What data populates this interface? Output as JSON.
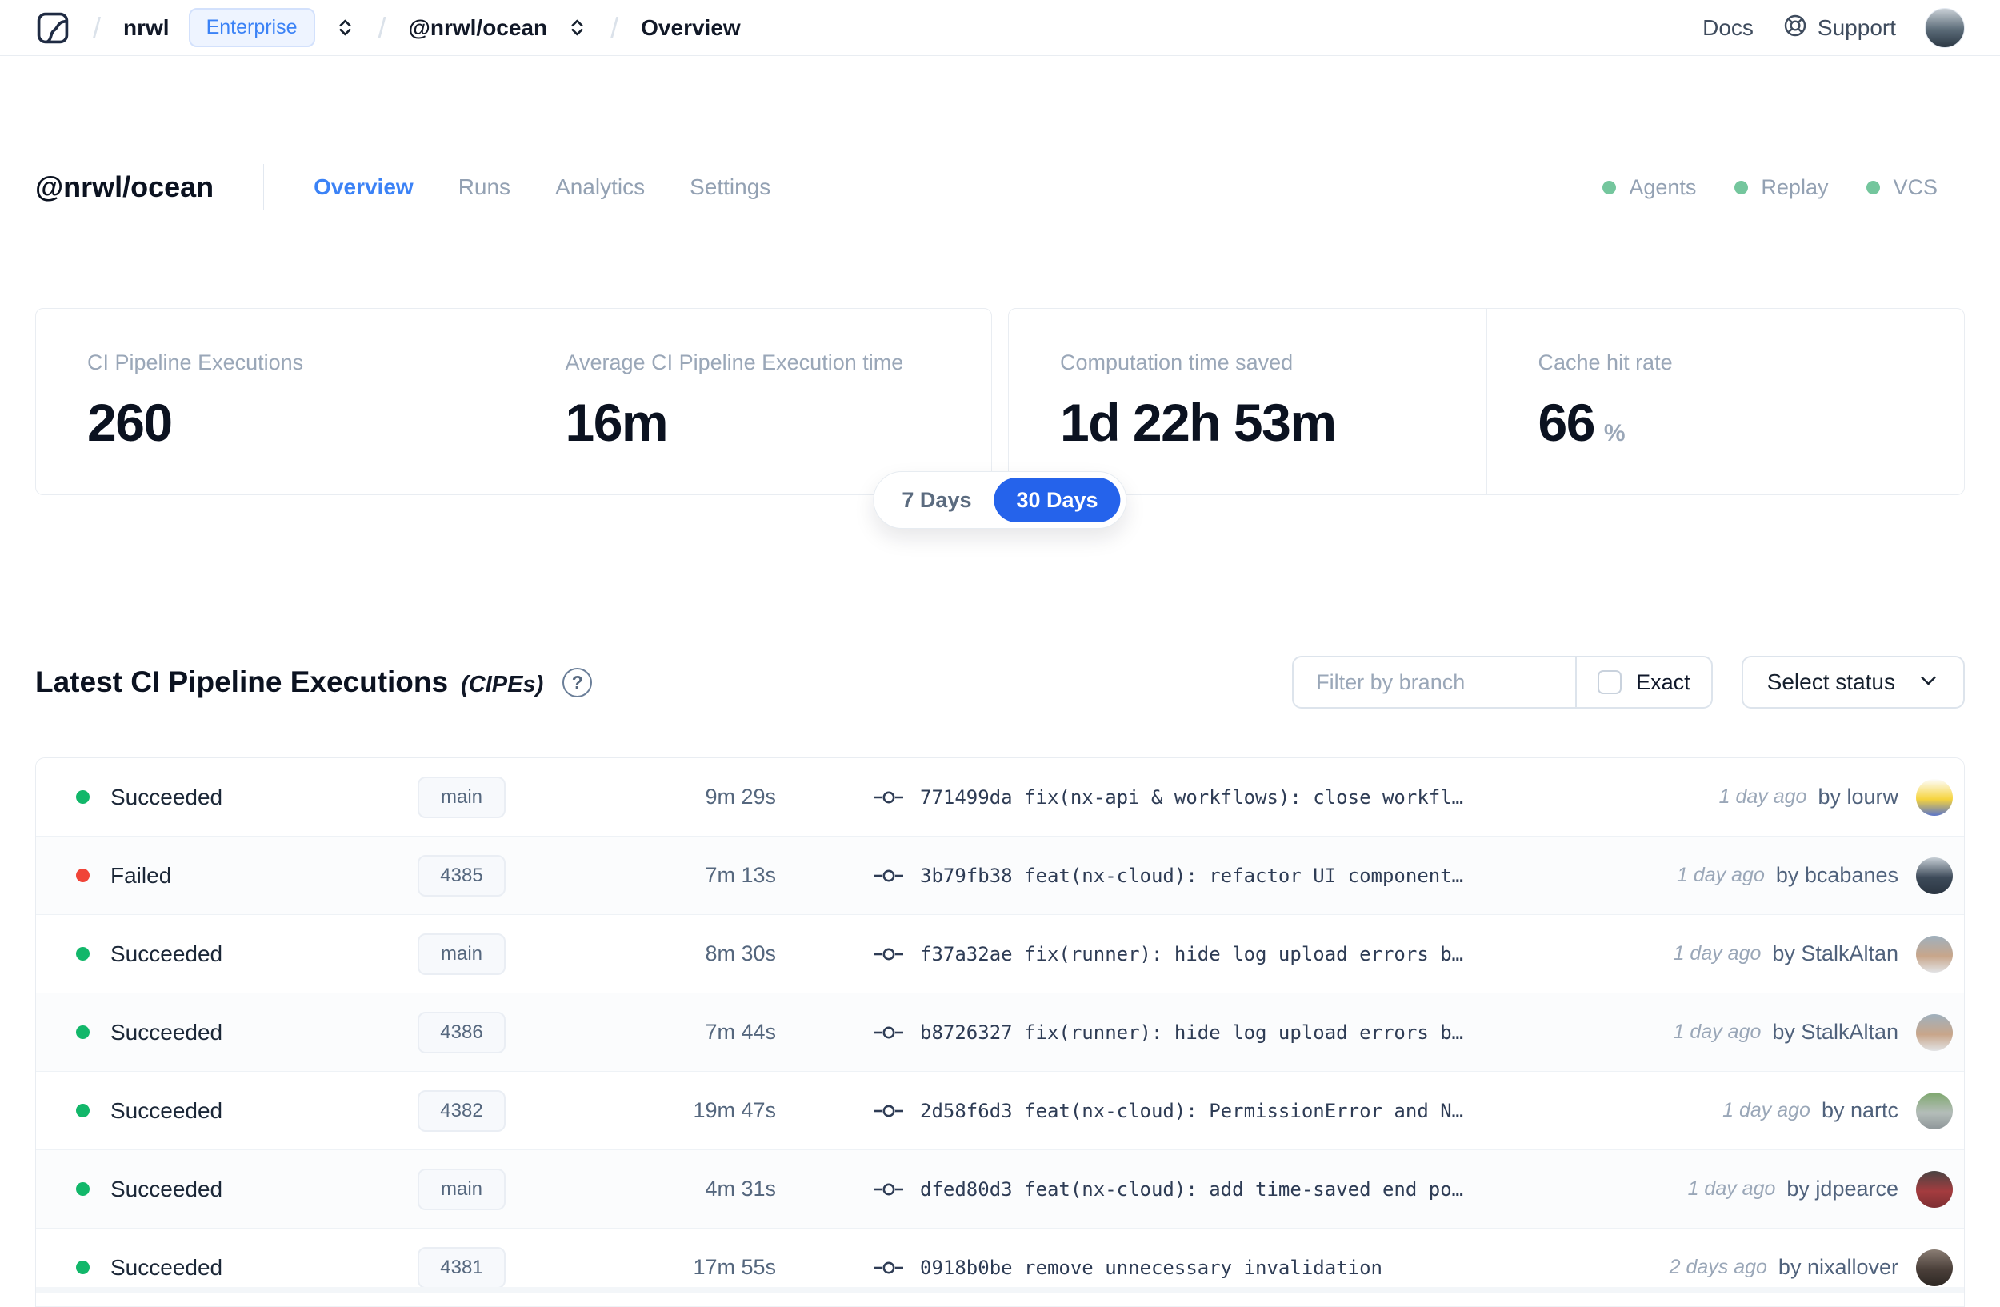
{
  "navbar": {
    "breadcrumb": {
      "org": "nrwl",
      "org_badge": "Enterprise",
      "workspace": "@nrwl/ocean",
      "page": "Overview"
    },
    "docs": "Docs",
    "support": "Support",
    "user_avatar_colors": [
      "#c9d0d6",
      "#5a6a77",
      "#2c3844"
    ]
  },
  "workspace_header": {
    "title": "@nrwl/ocean",
    "tabs": [
      {
        "label": "Overview",
        "active": true
      },
      {
        "label": "Runs",
        "active": false
      },
      {
        "label": "Analytics",
        "active": false
      },
      {
        "label": "Settings",
        "active": false
      }
    ],
    "statuses": [
      {
        "label": "Agents",
        "color": "#74c69d"
      },
      {
        "label": "Replay",
        "color": "#74c69d"
      },
      {
        "label": "VCS",
        "color": "#74c69d"
      }
    ]
  },
  "stats": {
    "cards": [
      {
        "label": "CI Pipeline Executions",
        "value": "260",
        "suffix": ""
      },
      {
        "label": "Average CI Pipeline Execution time",
        "value": "16m",
        "suffix": ""
      },
      {
        "label": "Computation time saved",
        "value": "1d 22h 53m",
        "suffix": ""
      },
      {
        "label": "Cache hit rate",
        "value": "66",
        "suffix": "%"
      }
    ],
    "range_toggle": {
      "options": [
        "7 Days",
        "30 Days"
      ],
      "selected": "30 Days"
    }
  },
  "cipe_section": {
    "title": "Latest CI Pipeline Executions",
    "title_suffix": "(CIPEs)",
    "help_glyph": "?",
    "filter": {
      "placeholder": "Filter by branch",
      "exact_label": "Exact",
      "exact_checked": false
    },
    "status_dropdown": {
      "label": "Select status"
    },
    "rows": [
      {
        "status": "Succeeded",
        "status_color": "#12b76a",
        "branch": "main",
        "duration": "9m 29s",
        "commit": "771499da fix(nx-api & workflows): close workfl…",
        "time": "1 day ago",
        "author": "by lourw",
        "avatar": [
          "#fdfdfd",
          "#f6d43e",
          "#5a74c9"
        ]
      },
      {
        "status": "Failed",
        "status_color": "#f04438",
        "branch": "4385",
        "duration": "7m 13s",
        "commit": "3b79fb38 feat(nx-cloud): refactor UI component…",
        "time": "1 day ago",
        "author": "by bcabanes",
        "avatar": [
          "#c7cfd6",
          "#3d4a59",
          "#2b3642"
        ]
      },
      {
        "status": "Succeeded",
        "status_color": "#12b76a",
        "branch": "main",
        "duration": "8m 30s",
        "commit": "f37a32ae fix(runner): hide log upload errors b…",
        "time": "1 day ago",
        "author": "by StalkAltan",
        "avatar": [
          "#9fb0bd",
          "#c8a68a",
          "#e2e3e5"
        ]
      },
      {
        "status": "Succeeded",
        "status_color": "#12b76a",
        "branch": "4386",
        "duration": "7m 44s",
        "commit": "b8726327 fix(runner): hide log upload errors b…",
        "time": "1 day ago",
        "author": "by StalkAltan",
        "avatar": [
          "#9fb0bd",
          "#c8a68a",
          "#e2e3e5"
        ]
      },
      {
        "status": "Succeeded",
        "status_color": "#12b76a",
        "branch": "4382",
        "duration": "19m 47s",
        "commit": "2d58f6d3 feat(nx-cloud): PermissionError and N…",
        "time": "1 day ago",
        "author": "by nartc",
        "avatar": [
          "#7fa86f",
          "#b4bdb9",
          "#8e9699"
        ]
      },
      {
        "status": "Succeeded",
        "status_color": "#12b76a",
        "branch": "main",
        "duration": "4m 31s",
        "commit": "dfed80d3 feat(nx-cloud): add time-saved end po…",
        "time": "1 day ago",
        "author": "by jdpearce",
        "avatar": [
          "#4a4443",
          "#a43c3f",
          "#7e2f33"
        ]
      },
      {
        "status": "Succeeded",
        "status_color": "#12b76a",
        "branch": "4381",
        "duration": "17m 55s",
        "commit": "0918b0be remove unnecessary invalidation",
        "time": "2 days ago",
        "author": "by nixallover",
        "avatar": [
          "#8a7d74",
          "#4a3f39",
          "#2e2824"
        ]
      }
    ]
  },
  "colors": {
    "accent_blue": "#2563eb",
    "tab_active_blue": "#3b82f6",
    "enterprise_blue": "#3b82f6",
    "workspace_status_green": "#74c69d",
    "succeeded_green": "#12b76a",
    "failed_red": "#f04438"
  }
}
